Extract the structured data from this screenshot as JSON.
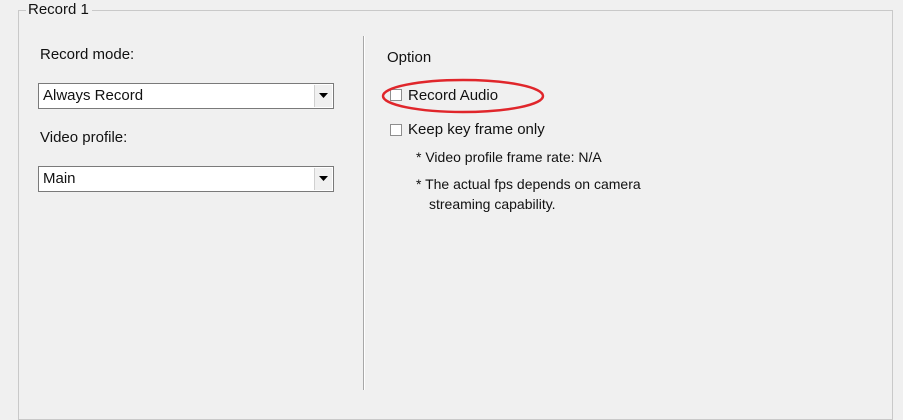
{
  "group": {
    "title": "Record 1"
  },
  "left": {
    "record_mode_label": "Record mode:",
    "record_mode_value": "Always Record",
    "video_profile_label": "Video profile:",
    "video_profile_value": "Main"
  },
  "option": {
    "title": "Option",
    "record_audio_label": "Record Audio",
    "record_audio_checked": false,
    "keep_key_frame_label": "Keep key frame only",
    "keep_key_frame_checked": false,
    "note1": "* Video profile frame rate: N/A",
    "note2_line1": "* The actual fps depends on camera",
    "note2_line2": "streaming capability."
  },
  "annotation": {
    "highlight_color": "#e0262b"
  },
  "icons": {
    "dropdown": "chevron-down-icon"
  }
}
